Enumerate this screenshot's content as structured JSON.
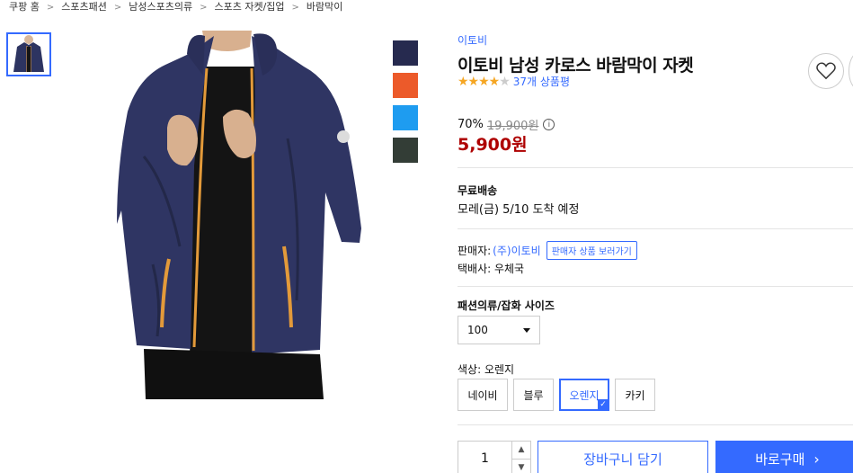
{
  "breadcrumb": [
    "쿠팡 홈",
    "스포츠패션",
    "남성스포츠의류",
    "스포츠 자켓/집업",
    "바람막이"
  ],
  "breadcrumb_separator": ">",
  "product": {
    "brand": "이토비",
    "title": "이토비 남성 카로스 바람막이 자켓",
    "rating": 4,
    "rating_max": 5,
    "review_count": "37개 상품평",
    "discount": "70%",
    "original_price": "19,900원",
    "sale_price": "5,900원"
  },
  "icons": {
    "wishlist": "heart-icon",
    "info": "info-icon",
    "check": "check-icon"
  },
  "colors": {
    "accent": "#346aff",
    "price_red": "#ae0000",
    "star": "#f5a623",
    "swatches": [
      "#262a4f",
      "#ec5a2a",
      "#1e9cf0",
      "#333d36"
    ]
  },
  "shipping": {
    "label": "무료배송",
    "date": "모레(금) 5/10 도착 예정"
  },
  "seller": {
    "prefix": "판매자:",
    "name": "(주)이토비",
    "store_button": "판매자 상품 보러가기",
    "courier": "택배사: 우체국"
  },
  "size": {
    "label": "패션의류/잡화 사이즈",
    "selected": "100"
  },
  "color_option": {
    "label": "색상: 오렌지",
    "options": [
      "네이비",
      "블루",
      "오렌지",
      "카키"
    ],
    "selected_index": 2
  },
  "purchase": {
    "quantity": "1",
    "up_glyph": "▲",
    "down_glyph": "▼",
    "cart_label": "장바구니 담기",
    "buy_label": "바로구매",
    "buy_arrow": "›"
  }
}
